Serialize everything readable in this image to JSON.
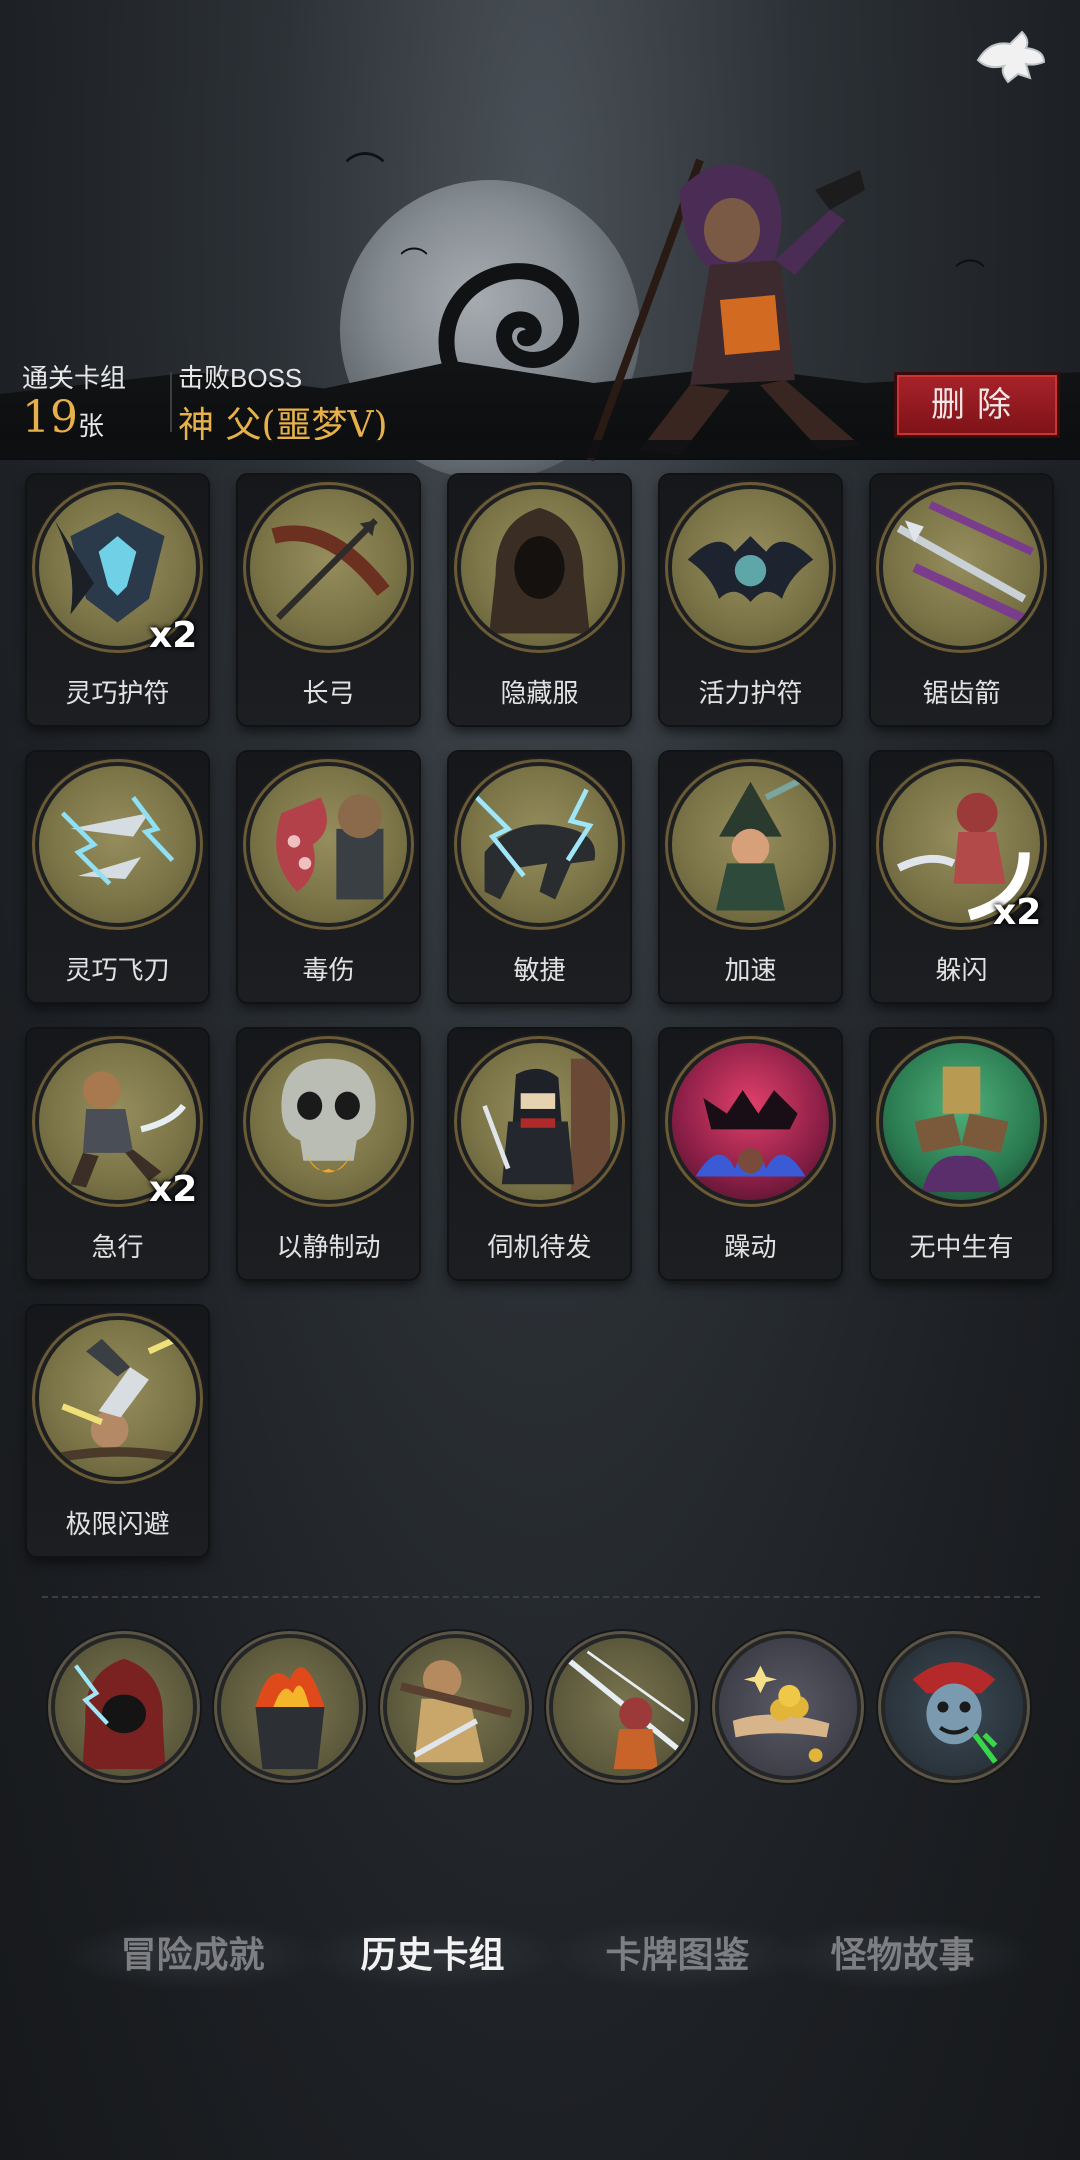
{
  "header": {
    "cleared_deck_label": "通关卡组",
    "cleared_deck_count": "19",
    "cleared_deck_unit": "张",
    "boss_label": "击败BOSS",
    "boss_name": "神 父(噩梦Ⅴ)",
    "delete_label": "删除"
  },
  "cards": [
    {
      "name": "灵巧护符",
      "count": "x2",
      "icon": "shield-amulet-icon"
    },
    {
      "name": "长弓",
      "count": "",
      "icon": "longbow-icon"
    },
    {
      "name": "隐藏服",
      "count": "",
      "icon": "hooded-cloak-icon"
    },
    {
      "name": "活力护符",
      "count": "",
      "icon": "bat-amulet-icon"
    },
    {
      "name": "锯齿箭",
      "count": "",
      "icon": "serrated-arrow-icon"
    },
    {
      "name": "灵巧飞刀",
      "count": "",
      "icon": "flying-knives-icon"
    },
    {
      "name": "毒伤",
      "count": "",
      "icon": "poison-tentacle-icon"
    },
    {
      "name": "敏捷",
      "count": "",
      "icon": "panther-icon"
    },
    {
      "name": "加速",
      "count": "",
      "icon": "witch-icon"
    },
    {
      "name": "躲闪",
      "count": "x2",
      "icon": "dodge-icon"
    },
    {
      "name": "急行",
      "count": "x2",
      "icon": "dash-warrior-icon"
    },
    {
      "name": "以静制动",
      "count": "",
      "icon": "skull-icon"
    },
    {
      "name": "伺机待发",
      "count": "",
      "icon": "ninja-icon"
    },
    {
      "name": "躁动",
      "count": "",
      "icon": "rage-icon"
    },
    {
      "name": "无中生有",
      "count": "",
      "icon": "summon-plant-icon"
    },
    {
      "name": "极限闪避",
      "count": "",
      "icon": "extreme-dodge-icon"
    }
  ],
  "relics": [
    {
      "icon": "hooded-rogue-icon"
    },
    {
      "icon": "fire-brazier-icon"
    },
    {
      "icon": "knife-monk-icon"
    },
    {
      "icon": "sword-slash-icon"
    },
    {
      "icon": "gold-coins-icon"
    },
    {
      "icon": "jester-icon"
    }
  ],
  "tabs": [
    {
      "label": "冒险成就",
      "active": false
    },
    {
      "label": "历史卡组",
      "active": true
    },
    {
      "label": "卡牌图鉴",
      "active": false
    },
    {
      "label": "怪物故事",
      "active": false
    }
  ],
  "colors": {
    "accent_gold": "#e6b04a",
    "delete_red": "#a8232a",
    "art_bg": "#958d5c"
  }
}
